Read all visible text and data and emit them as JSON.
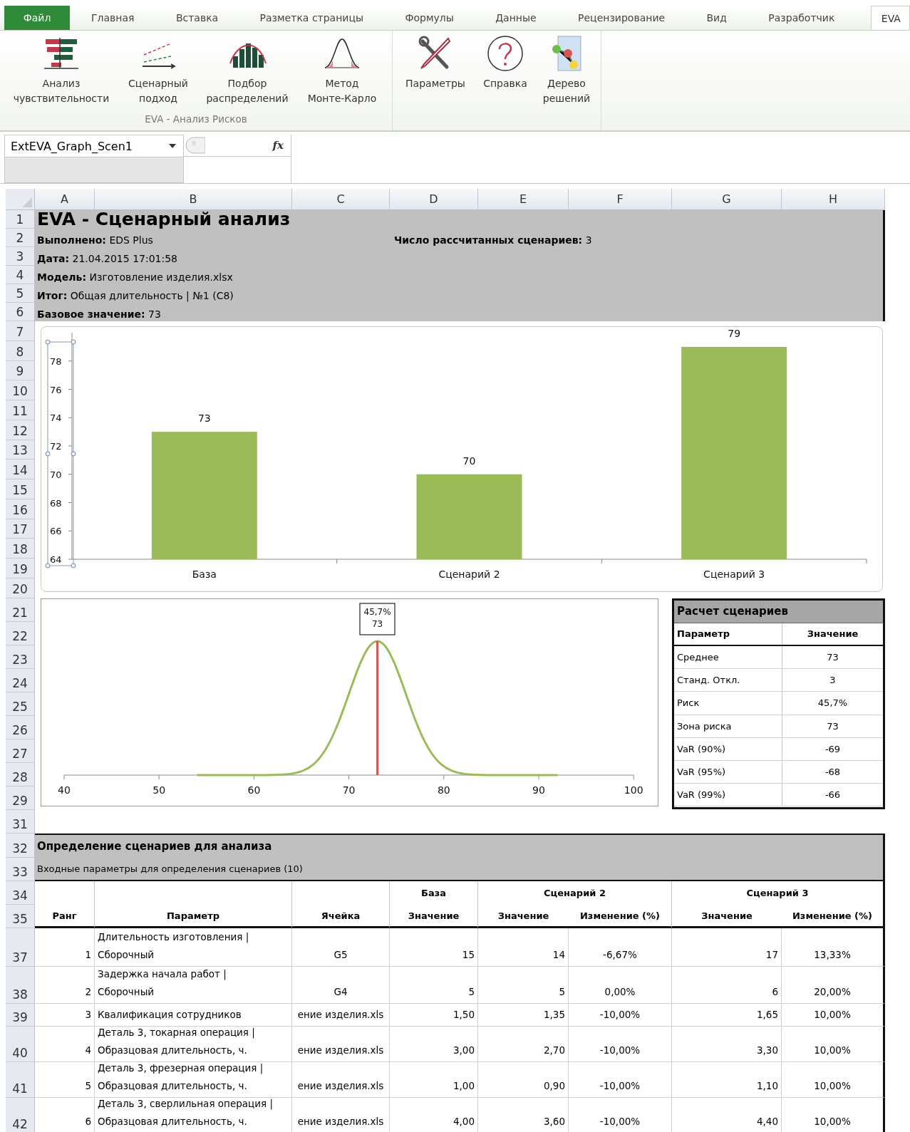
{
  "ribbon": {
    "file_tab": "Файл",
    "tabs": [
      {
        "label": "Главная",
        "selected": false
      },
      {
        "label": "Вставка",
        "selected": false
      },
      {
        "label": "Разметка страницы",
        "selected": false
      },
      {
        "label": "Формулы",
        "selected": false
      },
      {
        "label": "Данные",
        "selected": false
      },
      {
        "label": "Рецензирование",
        "selected": false
      },
      {
        "label": "Вид",
        "selected": false
      },
      {
        "label": "Разработчик",
        "selected": false
      },
      {
        "label": "EVA",
        "selected": true
      }
    ],
    "groups": [
      {
        "label": "EVA - Анализ Рисков",
        "buttons": [
          "Анализ\nчувствительности",
          "Сценарный\nподход",
          "Подбор\nраспределений",
          "Метод\nМонте-Карло"
        ]
      },
      {
        "buttons": [
          "Параметры",
          "Справка",
          "Дерево\nрешений"
        ]
      }
    ]
  },
  "formula_bar": {
    "name_box": "ExtEVA_Graph_Scen1",
    "function_label": "fx"
  },
  "columns": [
    "A",
    "B",
    "C",
    "D",
    "E",
    "F",
    "G",
    "H"
  ],
  "row_numbers": [
    "1",
    "2",
    "3",
    "4",
    "5",
    "6",
    "7",
    "8",
    "9",
    "10",
    "11",
    "12",
    "13",
    "14",
    "15",
    "16",
    "17",
    "18",
    "19",
    "20",
    "21",
    "22",
    "23",
    "24",
    "25",
    "26",
    "27",
    "28",
    "29",
    "31",
    "32",
    "33",
    "34",
    "35",
    "37",
    "38",
    "39",
    "40",
    "41",
    "42"
  ],
  "report_header": {
    "title": "EVA - Сценарный анализ",
    "lines": [
      "**Выполнено:** EDS Plus",
      "**Дата:** 21.04.2015 17:01:58",
      "**Модель:** Изготовление изделия.xlsx",
      "**Итог:** Общая длительность | №1 (C8)",
      "**Базовое значение:** 73"
    ],
    "scenario_count": "**Число рассчитанных сценариев:** 3"
  },
  "scenario_chart": {
    "chart_data": {
      "type": "bar",
      "categories": [
        "База",
        "Сценарий 2",
        "Сценарий 3"
      ],
      "values": [
        73,
        70,
        79
      ],
      "ylim": [
        64,
        80
      ],
      "yticks": [
        64,
        66,
        68,
        70,
        72,
        74,
        76,
        78
      ],
      "data_labels": true
    }
  },
  "distribution_chart": {
    "axis_labels": [
      "40",
      "50",
      "60",
      "70",
      "80",
      "90",
      "100"
    ],
    "marker_label": [
      "45,7%",
      "73"
    ]
  },
  "calc_table": {
    "title": "Расчет сценариев",
    "columns": [
      "Параметр",
      "Значение"
    ],
    "rows": [
      [
        "Среднее",
        "73"
      ],
      [
        "Станд. Откл.",
        "3"
      ],
      [
        "Риск",
        "45,7%"
      ],
      [
        "Зона риска",
        "73"
      ],
      [
        "VaR (90%)",
        "-69"
      ],
      [
        "VaR (95%)",
        "-68"
      ],
      [
        "VaR (99%)",
        "-66"
      ]
    ]
  },
  "definition": {
    "title": "Определение сценариев для анализа",
    "subtitle": "Входные параметры для определения сценариев (10)",
    "groups": [
      "База",
      "Сценарий 2",
      "Сценарий 3"
    ],
    "columns": [
      "Ранг",
      "Параметр",
      "Ячейка",
      "Значение",
      "Значение",
      "Изменение (%)",
      "Значение",
      "Изменение (%)"
    ],
    "rows": [
      [
        "1",
        "Длительность изготовления |\nСборочный",
        "G5",
        "15",
        "14",
        "-6,67%",
        "17",
        "13,33%"
      ],
      [
        "2",
        "Задержка начала работ |\nСборочный",
        "G4",
        "5",
        "5",
        "0,00%",
        "6",
        "20,00%"
      ],
      [
        "3",
        "Квалификация сотрудников",
        "ение изделия.xls",
        "1,50",
        "1,35",
        "-10,00%",
        "1,65",
        "10,00%"
      ],
      [
        "4",
        "Деталь 3, токарная операция |\nОбразцовая длительность, ч.",
        "ение изделия.xls",
        "3,00",
        "2,70",
        "-10,00%",
        "3,30",
        "10,00%"
      ],
      [
        "5",
        "Деталь 3, фрезерная операция |\nОбразцовая длительность, ч.",
        "ение изделия.xls",
        "1,00",
        "0,90",
        "-10,00%",
        "1,10",
        "10,00%"
      ],
      [
        "6",
        "Деталь 3, сверлильная операция |\nОбразцовая длительность, ч.",
        "ение изделия.xls",
        "4,00",
        "3,60",
        "-10,00%",
        "4,40",
        "10,00%"
      ]
    ]
  }
}
